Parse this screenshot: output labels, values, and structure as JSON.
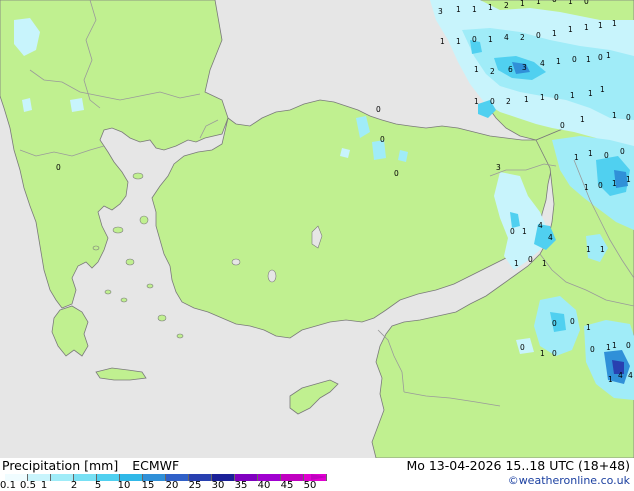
{
  "header": {
    "title": "Precipitation [mm]",
    "model": "ECMWF",
    "datetime": "Mo 13-04-2026 15..18 UTC (18+48)",
    "credit": "©weatheronline.co.uk"
  },
  "legend": {
    "ticks": [
      "0.1",
      "0.5",
      "1",
      "2",
      "5",
      "10",
      "15",
      "20",
      "25",
      "30",
      "35",
      "40",
      "45",
      "50"
    ],
    "colors": [
      "#f0fcff",
      "#c8f4fc",
      "#a0ecf8",
      "#78e0f4",
      "#50d0f0",
      "#30b8e8",
      "#3090d8",
      "#3060c8",
      "#2840b0",
      "#1a2098",
      "#8000c0",
      "#a000d0",
      "#c000c0",
      "#e000d0"
    ]
  },
  "map_colors": {
    "sea": "#e6e6e6",
    "land_forecast": "#c0f090",
    "precip_light": "#c8f4fc",
    "precip_moderate": "#a0ecf8",
    "precip_heavy": "#50d0f0",
    "precip_intense": "#3090d8",
    "coastline": "#7a7a7a",
    "border": "#9a9a9a"
  },
  "map_labels": {
    "values": [
      "3",
      "1",
      "1",
      "1",
      "2",
      "1",
      "1",
      "0",
      "1",
      "0",
      "1",
      "1",
      "0",
      "1",
      "4",
      "2",
      "0",
      "1",
      "1",
      "1",
      "1",
      "1",
      "1",
      "0",
      "1",
      "0",
      "1",
      "4",
      "3",
      "6",
      "2",
      "1",
      "1",
      "1",
      "1",
      "0",
      "1",
      "1",
      "2",
      "0",
      "1",
      "0",
      "1",
      "1",
      "0",
      "1",
      "1",
      "0",
      "0",
      "1",
      "0",
      "1",
      "1",
      "0",
      "1",
      "4",
      "4",
      "1",
      "1",
      "1",
      "0",
      "1",
      "0",
      "0",
      "1",
      "0",
      "1",
      "0",
      "0",
      "1",
      "1",
      "0",
      "1",
      "4",
      "4",
      "3",
      "0",
      "0",
      "0",
      "0"
    ]
  }
}
